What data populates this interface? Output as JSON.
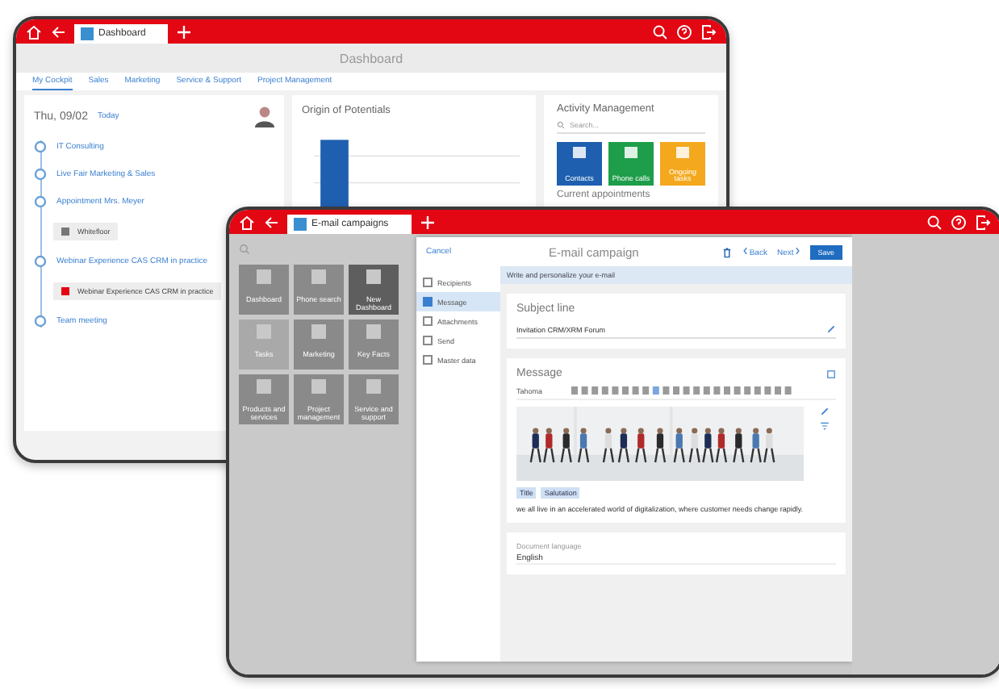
{
  "back_window": {
    "tab": "Dashboard",
    "title": "Dashboard",
    "nav_tabs": [
      {
        "label": "My Cockpit",
        "selected": true
      },
      {
        "label": "Sales",
        "selected": false
      },
      {
        "label": "Marketing",
        "selected": false
      },
      {
        "label": "Service & Support",
        "selected": false
      },
      {
        "label": "Project Management",
        "selected": false
      }
    ],
    "agenda": {
      "date": "Thu, 09/02",
      "today": "Today",
      "items": [
        {
          "kind": "appointment",
          "title": "IT Consulting"
        },
        {
          "kind": "appointment",
          "title": "Live Fair Marketing & Sales"
        },
        {
          "kind": "appointment",
          "title": "Appointment Mrs. Meyer"
        },
        {
          "kind": "attachment",
          "title": "Whitefloor",
          "color": "#777777"
        },
        {
          "kind": "appointment",
          "title": "Webinar Experience CAS CRM in practice"
        },
        {
          "kind": "attachment",
          "title": "Webinar Experience CAS CRM in practice",
          "color": "#e30613"
        },
        {
          "kind": "appointment",
          "title": "Team meeting"
        }
      ]
    },
    "chart_card": {
      "title": "Origin of Potentials"
    },
    "activity": {
      "title": "Activity Management",
      "search_placeholder": "Search...",
      "tiles": [
        {
          "label": "Contacts",
          "color": "#1f5fb0"
        },
        {
          "label": "Phone calls",
          "color": "#1e9e4a"
        },
        {
          "label": "Ongoing tasks",
          "color": "#f4a81d"
        }
      ],
      "current": "Current appointments"
    }
  },
  "front_window": {
    "tab": "E-mail campaigns",
    "tiles": [
      {
        "label": "Dashboard",
        "kind": "plain"
      },
      {
        "label": "Phone search",
        "kind": "plain"
      },
      {
        "label": "New Dashboard",
        "kind": "dark"
      },
      {
        "label": "Tasks",
        "kind": "faded"
      },
      {
        "label": "Marketing",
        "kind": "plain"
      },
      {
        "label": "Key Facts",
        "kind": "plain"
      },
      {
        "label": "Products and services",
        "kind": "plain"
      },
      {
        "label": "Project management",
        "kind": "plain"
      },
      {
        "label": "Service and support",
        "kind": "plain"
      }
    ],
    "campaign": {
      "cancel": "Cancel",
      "title": "E-mail campaign",
      "back": "Back",
      "next": "Next",
      "save": "Save",
      "steps": [
        {
          "label": "Recipients",
          "selected": false
        },
        {
          "label": "Message",
          "selected": true
        },
        {
          "label": "Attachments",
          "selected": false
        },
        {
          "label": "Send",
          "selected": false
        },
        {
          "label": "Master data",
          "selected": false
        }
      ],
      "hint": "Write and personalize your e-mail",
      "subject": {
        "label": "Subject line",
        "value": "Invitation CRM/XRM Forum"
      },
      "message": {
        "label": "Message",
        "font": "Tahoma",
        "tags": [
          "Title",
          "Salutation"
        ],
        "body": "we all live in an accelerated world of digitalization, where customer needs change rapidly."
      },
      "language": {
        "label": "Document language",
        "value": "English"
      }
    }
  }
}
